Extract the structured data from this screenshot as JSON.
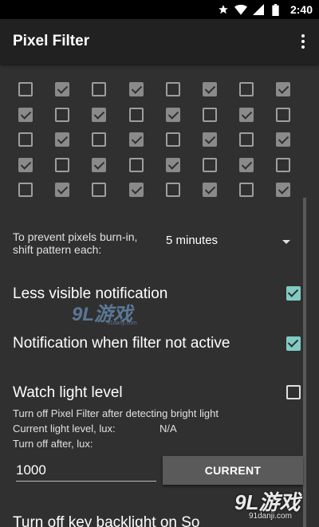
{
  "status_bar": {
    "time": "2:40",
    "icons": [
      "star-icon",
      "wifi-icon",
      "signal-icon",
      "battery-icon"
    ]
  },
  "app_bar": {
    "title": "Pixel Filter",
    "menu_icon": "more-vert-icon"
  },
  "pattern_grid": {
    "rows": [
      [
        false,
        true,
        false,
        true,
        false,
        true,
        false,
        true
      ],
      [
        true,
        false,
        true,
        false,
        true,
        false,
        true,
        false
      ],
      [
        false,
        true,
        false,
        true,
        false,
        true,
        false,
        true
      ],
      [
        true,
        false,
        true,
        false,
        true,
        false,
        true,
        false
      ],
      [
        false,
        true,
        false,
        true,
        false,
        true,
        false,
        true
      ]
    ]
  },
  "shift": {
    "label": "To prevent pixels burn-in, shift pattern each:",
    "value": "5 minutes"
  },
  "prefs": {
    "less_visible": {
      "label": "Less visible notification",
      "checked": true
    },
    "notif_inactive": {
      "label": "Notification when filter not active",
      "checked": true
    },
    "watch_light": {
      "label": "Watch light level",
      "checked": false,
      "summary": "Turn off Pixel Filter after detecting bright light",
      "current_label": "Current light level, lux:",
      "current_value": "N/A",
      "turn_off_label": "Turn off after, lux:",
      "lux_value": "1000",
      "current_button": "CURRENT"
    },
    "backlight": {
      "label": "Turn off key backlight on So"
    }
  },
  "watermarks": {
    "top": {
      "big": "9L游戏",
      "small": "91danji.com"
    },
    "bottom": {
      "big": "9L游戏",
      "small": "91danji.com"
    }
  },
  "colors": {
    "accent": "#80cbc4",
    "background": "#303030",
    "app_bar": "#212121"
  }
}
